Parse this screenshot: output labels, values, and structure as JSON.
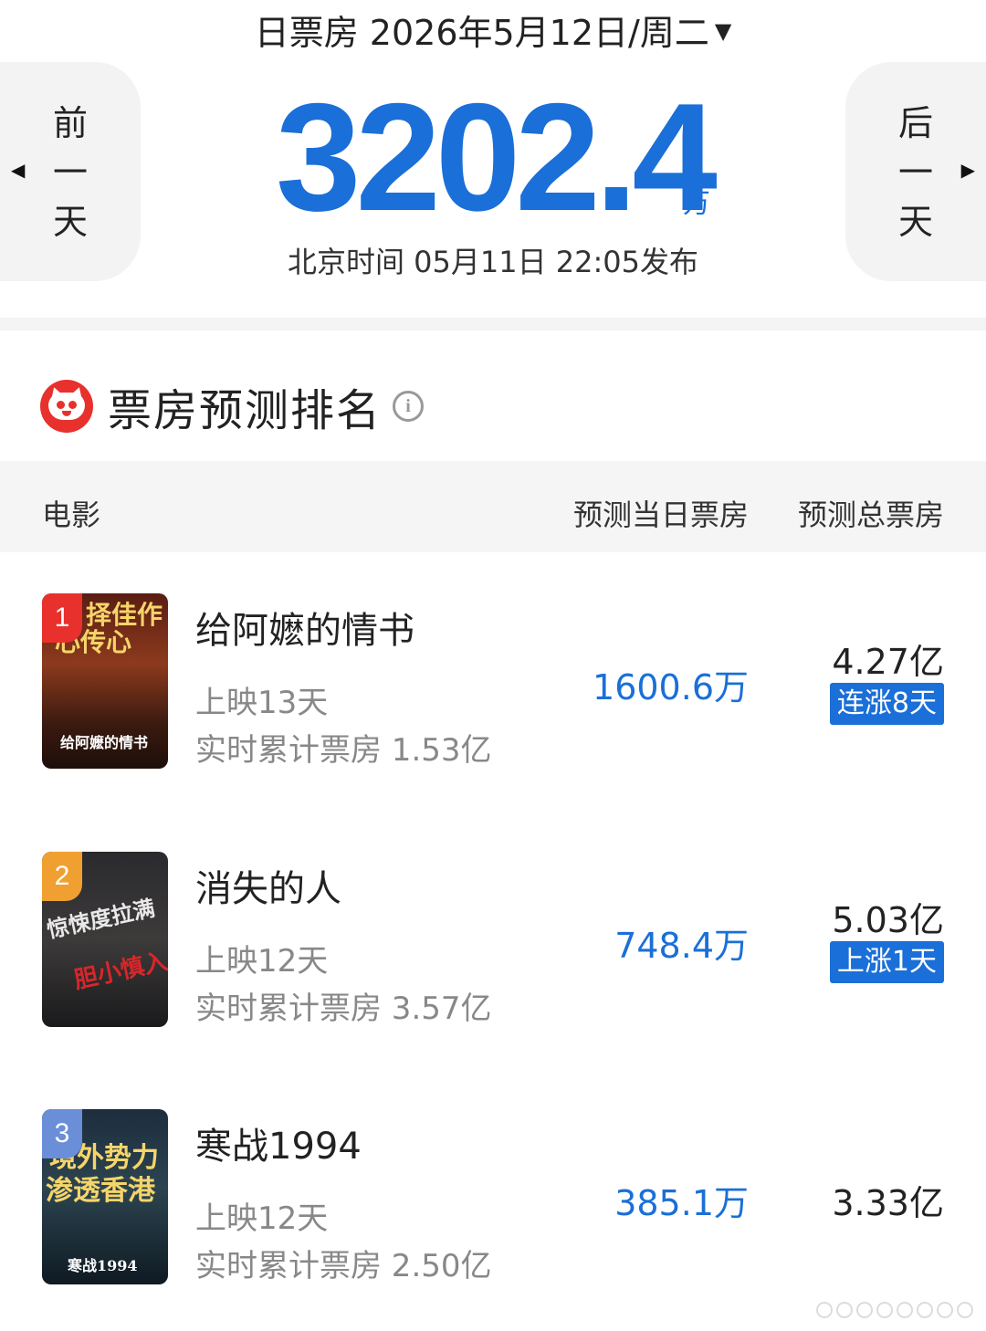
{
  "header": {
    "date_title": "日票房 2026年5月12日/周二"
  },
  "nav": {
    "prev_chars": [
      "前",
      "一",
      "天"
    ],
    "next_chars": [
      "后",
      "一",
      "天"
    ]
  },
  "summary": {
    "total_value": "3202.4",
    "total_unit": "万",
    "publish_time": "北京时间  05月11日  22:05发布"
  },
  "section": {
    "title": "票房预测排名"
  },
  "table": {
    "col_movie": "电影",
    "col_daily": "预测当日票房",
    "col_total": "预测总票房"
  },
  "movies": [
    {
      "rank": "1",
      "name": "给阿嬷的情书",
      "days": "上映13天",
      "cumulative": "实时累计票房 1.53亿",
      "daily_pred": "1600.6万",
      "total_pred": "4.27亿",
      "trend": "连涨8天",
      "badge_color": "#e8312c",
      "poster_text_top": "择佳作",
      "poster_text_mid": "心传心",
      "poster_text_bottom": "给阿嬷的情书"
    },
    {
      "rank": "2",
      "name": "消失的人",
      "days": "上映12天",
      "cumulative": "实时累计票房 3.57亿",
      "daily_pred": "748.4万",
      "total_pred": "5.03亿",
      "trend": "上涨1天",
      "badge_color": "#f0a030",
      "poster_text_top": "惊悚度拉满",
      "poster_text_mid": "胆小慎入",
      "poster_text_bottom": ""
    },
    {
      "rank": "3",
      "name": "寒战1994",
      "days": "上映12天",
      "cumulative": "实时累计票房 2.50亿",
      "daily_pred": "385.1万",
      "total_pred": "3.33亿",
      "trend": "",
      "badge_color": "#6a8fd8",
      "poster_text_top": "境外势力",
      "poster_text_mid": "渗透香港",
      "poster_text_bottom": "寒战1994"
    }
  ]
}
